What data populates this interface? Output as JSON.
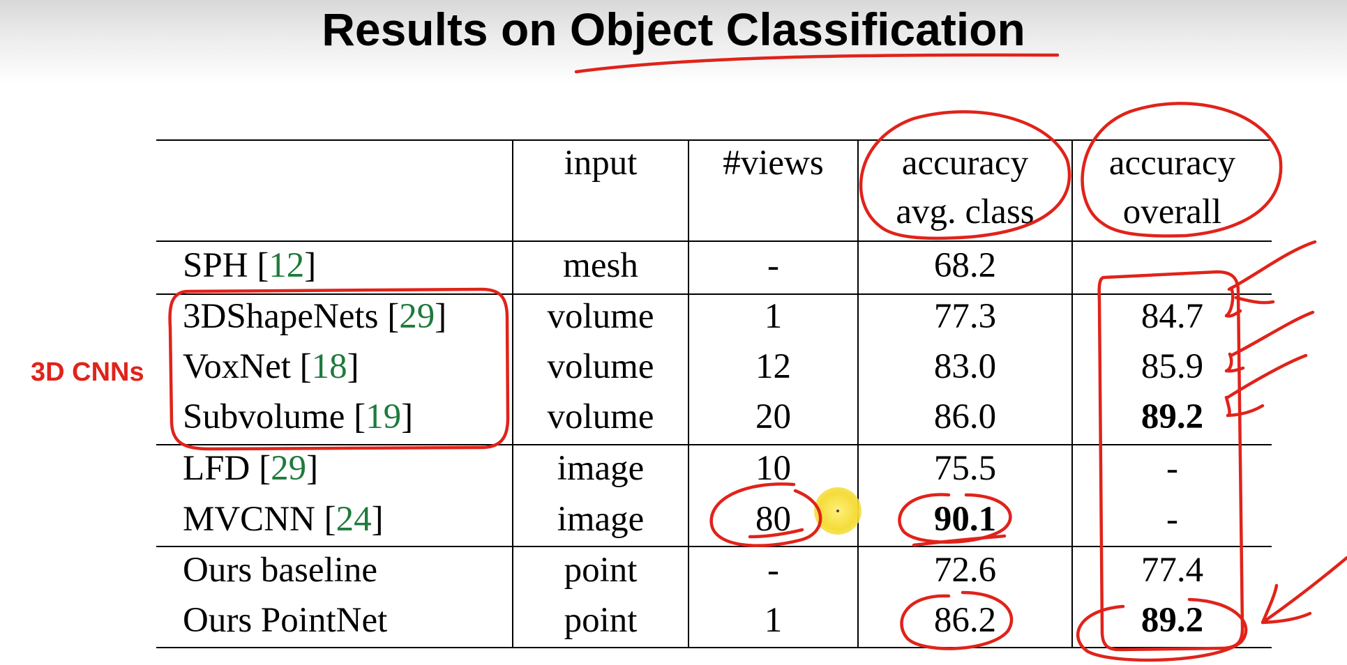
{
  "title": "Results on Object Classification",
  "side_label": "3D CNNs",
  "columns": [
    "",
    "input",
    "#views",
    "accuracy\navg. class",
    "accuracy\noverall"
  ],
  "header": {
    "input": "input",
    "views": "#views",
    "acc_class_1": "accuracy",
    "acc_class_2": "avg. class",
    "acc_overall_1": "accuracy",
    "acc_overall_2": "overall"
  },
  "rows": [
    {
      "method": "SPH",
      "ref": "12",
      "input": "mesh",
      "views": "-",
      "acc_class": "68.2",
      "acc_overall": ""
    },
    {
      "method": "3DShapeNets",
      "ref": "29",
      "input": "volume",
      "views": "1",
      "acc_class": "77.3",
      "acc_overall": "84.7"
    },
    {
      "method": "VoxNet",
      "ref": "18",
      "input": "volume",
      "views": "12",
      "acc_class": "83.0",
      "acc_overall": "85.9"
    },
    {
      "method": "Subvolume",
      "ref": "19",
      "input": "volume",
      "views": "20",
      "acc_class": "86.0",
      "acc_overall": "89.2"
    },
    {
      "method": "LFD",
      "ref": "29",
      "input": "image",
      "views": "10",
      "acc_class": "75.5",
      "acc_overall": "-"
    },
    {
      "method": "MVCNN",
      "ref": "24",
      "input": "image",
      "views": "80",
      "acc_class": "90.1",
      "acc_overall": "-"
    },
    {
      "method": "Ours baseline",
      "ref": "",
      "input": "point",
      "views": "-",
      "acc_class": "72.6",
      "acc_overall": "77.4"
    },
    {
      "method": "Ours PointNet",
      "ref": "",
      "input": "point",
      "views": "1",
      "acc_class": "86.2",
      "acc_overall": "89.2"
    }
  ],
  "bold_cells": [
    "3.acc_overall",
    "5.acc_class",
    "7.acc_overall"
  ],
  "colors": {
    "annotation": "#e0231a",
    "reference": "#1f7a3c",
    "pointer": "#f5dc3a"
  }
}
